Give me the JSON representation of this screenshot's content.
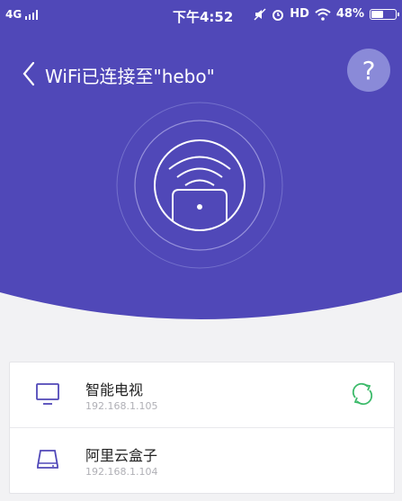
{
  "status_bar": {
    "network": "4G",
    "time": "下午4:52",
    "hd_label": "HD",
    "battery_percent": "48%",
    "battery_level": 0.48,
    "icons": [
      "mute-icon",
      "alarm-icon",
      "wifi-icon",
      "battery-icon"
    ]
  },
  "header": {
    "back_icon": "chevron-left-icon",
    "title": "WiFi已连接至\"hebo\"",
    "help_label": "?"
  },
  "hero": {
    "icon": "router-wifi-icon",
    "colors": {
      "background": "#5048b8",
      "accent_ring": "#8a8ad8"
    }
  },
  "devices": [
    {
      "name": "智能电视",
      "ip": "192.168.1.105",
      "icon": "tv-icon",
      "action_icon": "refresh-icon",
      "action_color": "#3cba6a"
    },
    {
      "name": "阿里云盒子",
      "ip": "192.168.1.104",
      "icon": "hard-drive-icon"
    }
  ]
}
